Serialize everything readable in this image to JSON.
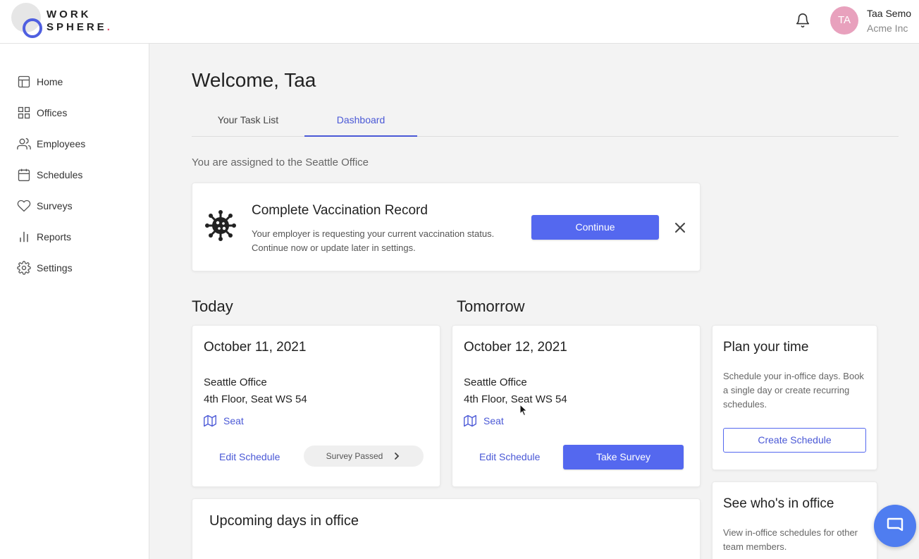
{
  "brand": {
    "line1": "WORK",
    "line2": "SPHERE",
    "dot": ".",
    "accent": "#4f5fe0",
    "dot_color": "#e24b6b"
  },
  "header": {
    "avatar_initials": "TA",
    "user_name": "Taa Semo",
    "org": "Acme Inc",
    "avatar_color": "#e8a1bd"
  },
  "sidebar": {
    "items": [
      {
        "label": "Home",
        "icon": "layout-icon"
      },
      {
        "label": "Offices",
        "icon": "grid-icon"
      },
      {
        "label": "Employees",
        "icon": "users-icon"
      },
      {
        "label": "Schedules",
        "icon": "calendar-icon"
      },
      {
        "label": "Surveys",
        "icon": "heart-icon"
      },
      {
        "label": "Reports",
        "icon": "bar-chart-icon"
      },
      {
        "label": "Settings",
        "icon": "gear-icon"
      }
    ]
  },
  "main": {
    "welcome": "Welcome, Taa",
    "tabs": [
      {
        "label": "Your Task List",
        "active": false
      },
      {
        "label": "Dashboard",
        "active": true
      }
    ],
    "assigned": "You are assigned to the Seattle Office",
    "vaccination": {
      "title": "Complete Vaccination Record",
      "desc_line1": "Your employer is requesting your current vaccination status.",
      "desc_line2": "Continue now or update later in settings.",
      "continue_label": "Continue"
    },
    "today": {
      "section": "Today",
      "date": "October 11, 2021",
      "office": "Seattle Office",
      "seat": "4th Floor, Seat WS 54",
      "seat_link": "Seat",
      "edit_label": "Edit Schedule",
      "survey_status": "Survey Passed"
    },
    "tomorrow": {
      "section": "Tomorrow",
      "date": "October 12, 2021",
      "office": "Seattle Office",
      "seat": "4th Floor, Seat WS 54",
      "seat_link": "Seat",
      "edit_label": "Edit Schedule",
      "survey_label": "Take Survey"
    },
    "plan": {
      "title": "Plan your time",
      "desc": "Schedule your in-office days. Book a single day or create recurring schedules.",
      "button": "Create Schedule"
    },
    "whos_in": {
      "title": "See who's in office",
      "desc": "View in-office schedules for other team members."
    },
    "upcoming": {
      "title": "Upcoming days in office"
    }
  },
  "colors": {
    "primary": "#5468ef",
    "link": "#4a58d6",
    "chat": "#4f7df0"
  }
}
